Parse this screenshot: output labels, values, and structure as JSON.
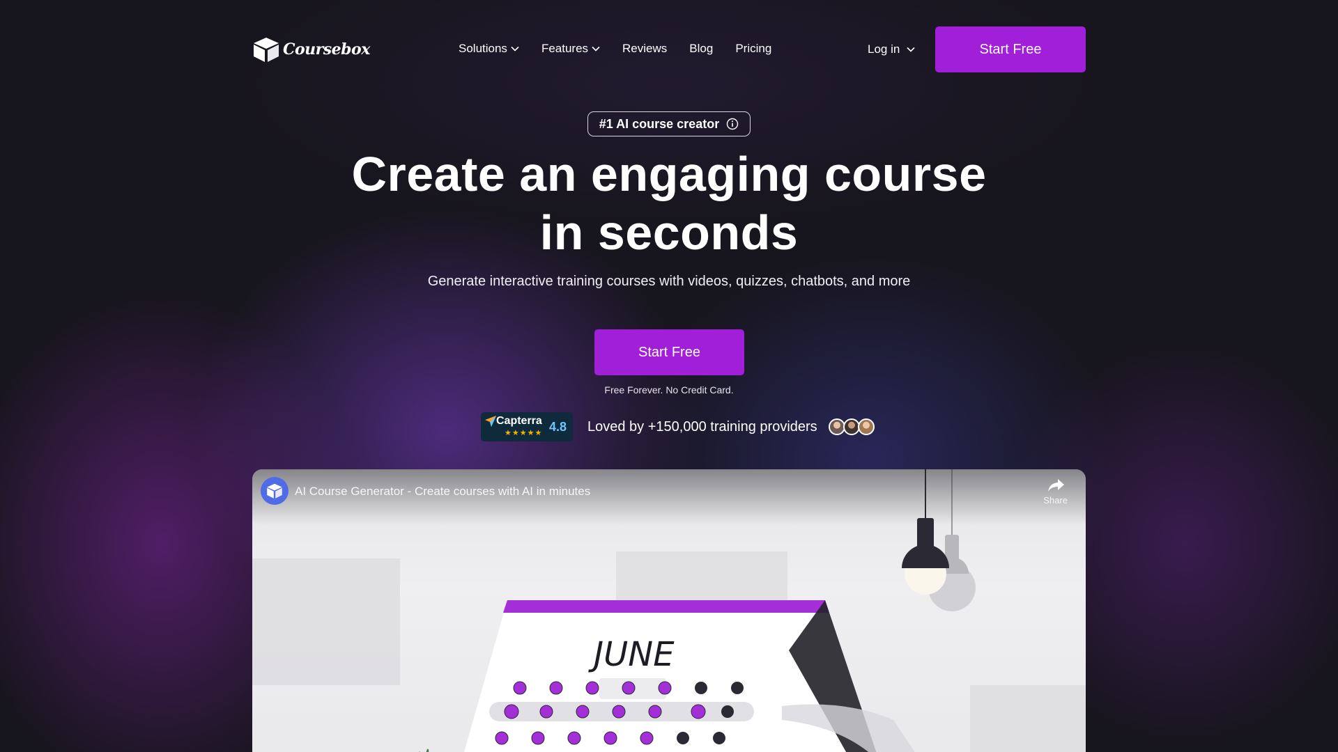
{
  "brand": {
    "name": "Coursebox"
  },
  "nav": {
    "items": [
      {
        "label": "Solutions",
        "has_dropdown": true
      },
      {
        "label": "Features",
        "has_dropdown": true
      },
      {
        "label": "Reviews",
        "has_dropdown": false
      },
      {
        "label": "Blog",
        "has_dropdown": false
      },
      {
        "label": "Pricing",
        "has_dropdown": false
      }
    ],
    "login_label": "Log in",
    "cta_label": "Start Free"
  },
  "hero": {
    "badge": "#1 AI course creator",
    "headline_line1": "Create an engaging course",
    "headline_line2": "in seconds",
    "subheadline": "Generate interactive training courses with videos, quizzes, chatbots, and more",
    "cta_label": "Start Free",
    "note": "Free Forever. No Credit Card."
  },
  "social_proof": {
    "capterra_label": "Capterra",
    "capterra_rating": "4.8",
    "capterra_stars": 5,
    "text": "Loved by +150,000 training providers"
  },
  "video": {
    "title": "AI Course Generator - Create courses with AI in minutes",
    "share_label": "Share",
    "scene_month": "JUNE"
  },
  "colors": {
    "accent": "#a21fd9",
    "background": "#17151d",
    "capterra_bg": "#0e2a3b"
  }
}
